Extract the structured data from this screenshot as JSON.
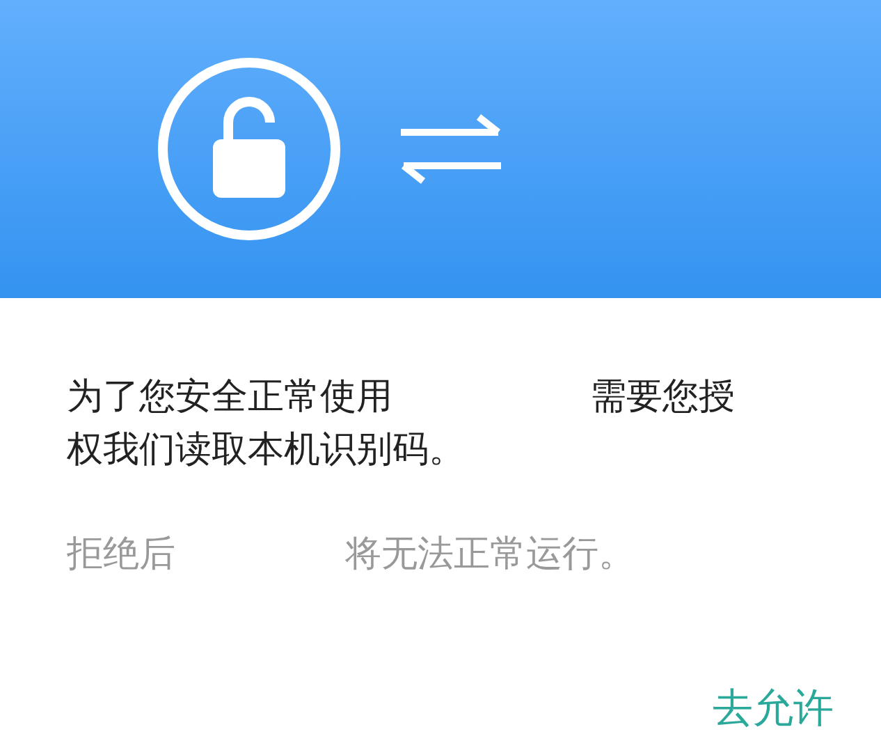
{
  "header": {
    "kind": "permission"
  },
  "message": {
    "lines": [
      [
        "为了您安全正常使用",
        "需要您授"
      ],
      [
        "权我们读取本机识别码。"
      ]
    ]
  },
  "note": [
    "拒绝后",
    "将无法正常运行。"
  ],
  "button": {
    "label": "去允许"
  }
}
